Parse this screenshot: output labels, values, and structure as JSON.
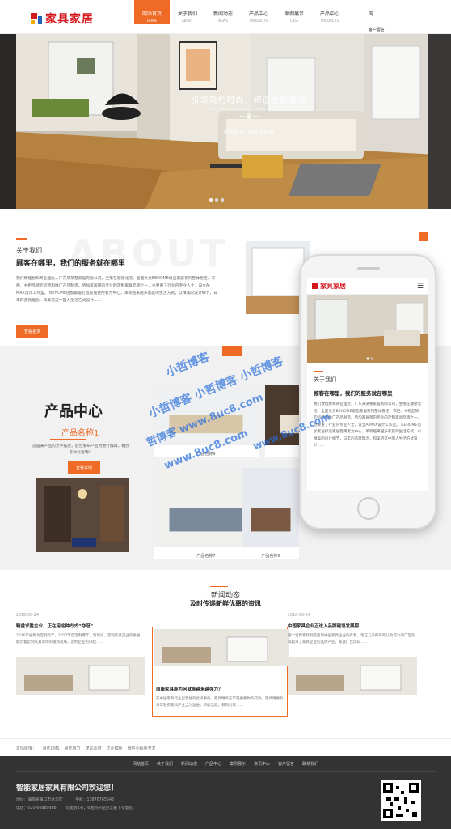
{
  "header": {
    "logo": "家具家居",
    "nav": [
      {
        "cn": "网站首页",
        "en": "HOME",
        "active": true
      },
      {
        "cn": "关于我们",
        "en": "ABOUT",
        "active": false
      },
      {
        "cn": "新闻动态",
        "en": "NEWS",
        "active": false
      },
      {
        "cn": "产品中心",
        "en": "PRODUCTS",
        "active": false
      },
      {
        "cn": "案例展示",
        "en": "CASE",
        "active": false
      },
      {
        "cn": "产品中心",
        "en": "PRODUCTS",
        "active": false
      }
    ],
    "cut_cn": "网",
    "cut_en": "客户留言"
  },
  "hero": {
    "title": "引领简约时尚，缔造全新舒适",
    "subtitle": "Lead the simple fashion, create new comfort",
    "tagline": "顾家史上，极致 好轻款"
  },
  "about": {
    "label": "关于我们",
    "bg_text": "ABOUT",
    "heading": "顾客在哪里，我们的服务就在哪里",
    "body": "我们致理想和商业理念，广东某某整家居有限公司，坐落在顺德北滘，全面负责BEHOME级品家居系列整体看柜、衣柜、书柜品牌的运营和推广产品制造。佰加家居国内专业的定制家具品牌之一，也要重了行业内专业人士，设立A-MAX设计工作室。 BEHOME佰加家居打造家居使用者为中心，革新越来越多家庭的生活方式，以精美的设计细节，日丰的造就理念，和美佰这中国人生活方式设计……",
    "more": "» 查看更多 »",
    "btn": "查看更多"
  },
  "products": {
    "title": "产品中心",
    "sub": "产品名称1",
    "desc": "这是某产品的文字描述，后台发布产品时进行编辑，相办非你比逗明！",
    "btn": "查看详情",
    "captions": [
      "产品名称9",
      "产品名称8",
      "产品名称7",
      "产品名称6"
    ]
  },
  "news": {
    "title": "新闻动态",
    "subtitle": "及时传递新鲜优惠的资讯",
    "items": [
      {
        "date": "2018-06-24",
        "title": "精益求胜企业，正在用这种方式“夺冠”",
        "excerpt": "2016年被称为定制元年，2017年度定制爆年，到现今，定制家具是业的发展，能示着定制家具市场的蓬勃发展。定制企业的兴起……"
      },
      {
        "date": "2018-06-24",
        "title": "南康家具能为何就能越来越强力？",
        "excerpt": "在中国家具行业里曾经的优点事的，家具精具在年轻要要你的贷款。家具精要有与年轻费家具产业当为运维，积极活跃，和和对家……"
      },
      {
        "date": "2018-06-24",
        "title": "中国家具企业正进入品牌建设发展期",
        "excerpt": "整个世界家具制造出现中国家具企业的有着，现在几乎所有的认为可以的广告的和起来了家具企业的品牌产业，家具广告比较……"
      }
    ]
  },
  "links": {
    "label": "友情链接：",
    "items": [
      "易优CMS",
      "易优官方",
      "建站素材",
      "优企模板",
      "微信小程序开发"
    ]
  },
  "footer": {
    "nav": [
      "网站首页",
      "关于我们",
      "新闻动态",
      "产品中心",
      "案例展示",
      "资讯中心",
      "客户留言",
      "联系我们"
    ],
    "company": "智能家居家具有限公司欢迎您！",
    "addr_label": "地址：",
    "addr": "海南省海口市龙华区",
    "phone_label": "手机：",
    "phone": "13876765548",
    "tel_label": "电话：",
    "tel": "020-66889988",
    "tail": "可能会1号，6路到开站分之最下令意见"
  },
  "phone": {
    "logo": "家具家居",
    "label": "关于我们",
    "heading": "顾客在哪里，我们的服务就在哪里",
    "body": "我们致理想和商业理念，广东某某整家居有限公司，坐落在顺德北滘，全面负责BEHOME级品家居系列整体看柜、衣柜、书柜品牌的运营和推广产品制造。佰加家居国内专业的定制家具品牌之一，也要重了行业内专业人士，设立A-MAX设计工作室。 BEHOME佰加家居打造家居使用者为中心，革新越来越多家庭的生活方式，以精美的设计细节，日丰的造就理念，和美佰这中国人生活方式设计……",
    "more": "» 查看更多 »"
  },
  "watermark": [
    "小哲博客",
    "小哲博客 小哲博客 小哲博客",
    "哲博客 www.8uc8.com",
    "www.8uc8.com",
    "www.8uc8.com"
  ],
  "colors": {
    "accent": "#ee6a25",
    "logo_red": "#d5171e",
    "footer_bg": "#333333"
  }
}
